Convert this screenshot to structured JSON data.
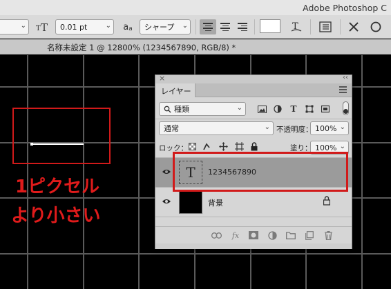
{
  "app": {
    "title": "Adobe Photoshop C"
  },
  "options_bar": {
    "font_size": "0.01 pt",
    "aa_label": "a",
    "aa_sub": "a",
    "antialias": "シャープ"
  },
  "document": {
    "tab_title": "名称未設定 1 @ 12800% (1234567890, RGB/8) *"
  },
  "annotation": {
    "line1": "1ピクセル",
    "line2": "より小さい"
  },
  "layers_panel": {
    "tab_label": "レイヤー",
    "close_glyph": "×",
    "collapse_glyph": "‹‹",
    "filter_label": "種類",
    "blend_mode": "通常",
    "opacity_label": "不透明度：",
    "opacity_value": "100%",
    "lock_label": "ロック：",
    "fill_label": "塗り：",
    "fill_value": "100%",
    "layers": [
      {
        "name": "1234567890",
        "kind": "text",
        "thumb_glyph": "T",
        "selected": true
      },
      {
        "name": "背景",
        "kind": "background",
        "locked": true
      }
    ]
  },
  "colors": {
    "accent_red": "#d11a1a",
    "callout_red": "#e01b1b",
    "canvas": "#000000",
    "panel_bg": "#d6d6d6"
  }
}
